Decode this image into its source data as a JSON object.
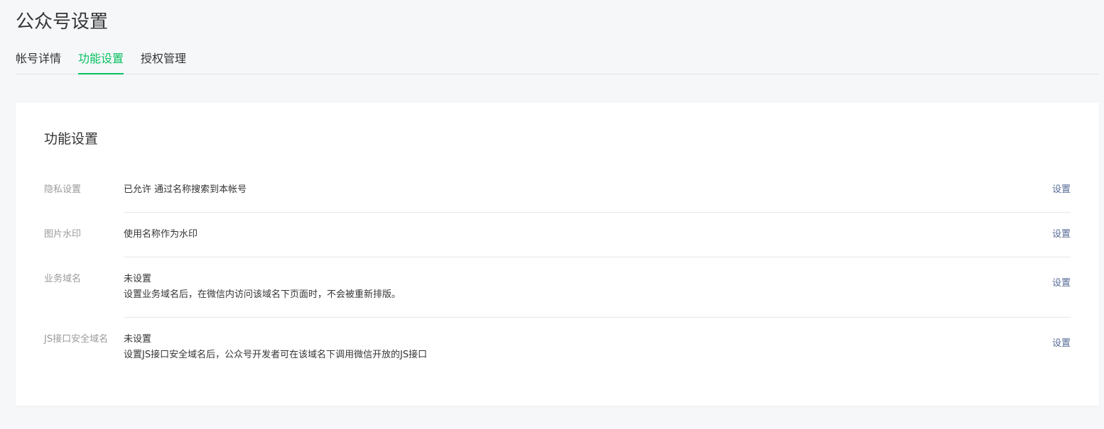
{
  "page": {
    "title": "公众号设置"
  },
  "tabs": [
    {
      "label": "帐号详情",
      "active": false
    },
    {
      "label": "功能设置",
      "active": true
    },
    {
      "label": "授权管理",
      "active": false
    }
  ],
  "card": {
    "title": "功能设置",
    "rows": [
      {
        "label": "隐私设置",
        "value": "已允许 通过名称搜索到本帐号",
        "desc": "",
        "action": "设置"
      },
      {
        "label": "图片水印",
        "value": "使用名称作为水印",
        "desc": "",
        "action": "设置"
      },
      {
        "label": "业务域名",
        "value": "未设置",
        "desc": "设置业务域名后，在微信内访问该域名下页面时，不会被重新排版。",
        "action": "设置"
      },
      {
        "label": "JS接口安全域名",
        "value": "未设置",
        "desc": "设置JS接口安全域名后，公众号开发者可在该域名下调用微信开放的JS接口",
        "action": "设置"
      }
    ]
  },
  "colors": {
    "accent": "#07c160",
    "link": "#576b95",
    "background": "#f6f7f9"
  }
}
